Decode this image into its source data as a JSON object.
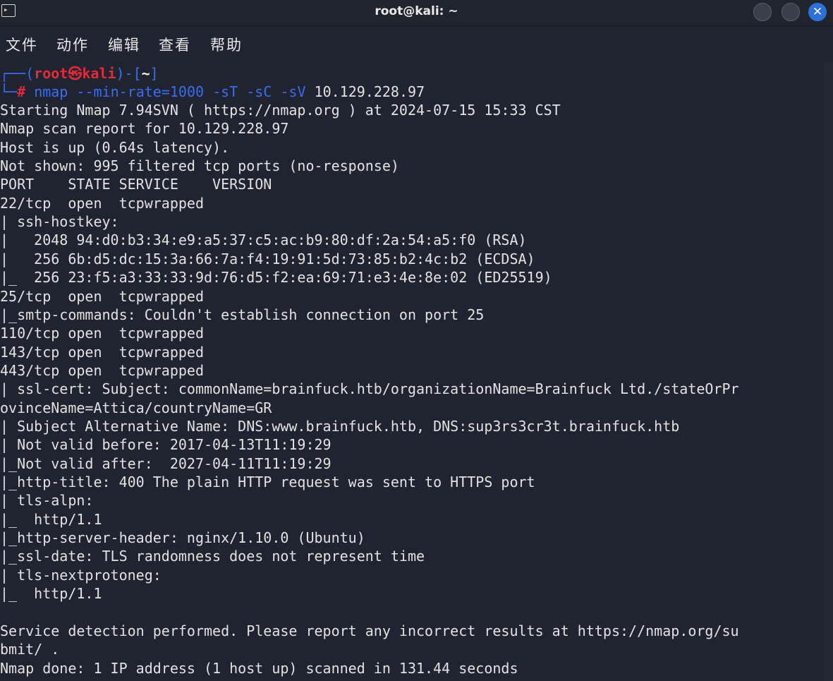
{
  "window": {
    "title": "root@kali: ~",
    "close_glyph": "✕",
    "icon_glyph": "▸"
  },
  "menu": {
    "items": [
      "文件",
      "动作",
      "编辑",
      "查看",
      "帮助"
    ]
  },
  "prompt": {
    "frame_open": "┌──(",
    "user": "root㉿kali",
    "frame_mid": ")-[",
    "dir": "~",
    "frame_close": "]",
    "frame_bottom": "└─",
    "hash": "#",
    "command": "nmap",
    "args": "--min-rate=1000 -sT -sC -sV",
    "target": "10.129.228.97"
  },
  "output": [
    "Starting Nmap 7.94SVN ( https://nmap.org ) at 2024-07-15 15:33 CST",
    "Nmap scan report for 10.129.228.97",
    "Host is up (0.64s latency).",
    "Not shown: 995 filtered tcp ports (no-response)",
    "PORT    STATE SERVICE    VERSION",
    "22/tcp  open  tcpwrapped",
    "| ssh-hostkey:",
    "|   2048 94:d0:b3:34:e9:a5:37:c5:ac:b9:80:df:2a:54:a5:f0 (RSA)",
    "|   256 6b:d5:dc:15:3a:66:7a:f4:19:91:5d:73:85:b2:4c:b2 (ECDSA)",
    "|_  256 23:f5:a3:33:33:9d:76:d5:f2:ea:69:71:e3:4e:8e:02 (ED25519)",
    "25/tcp  open  tcpwrapped",
    "|_smtp-commands: Couldn't establish connection on port 25",
    "110/tcp open  tcpwrapped",
    "143/tcp open  tcpwrapped",
    "443/tcp open  tcpwrapped",
    "| ssl-cert: Subject: commonName=brainfuck.htb/organizationName=Brainfuck Ltd./stateOrPr",
    "ovinceName=Attica/countryName=GR",
    "| Subject Alternative Name: DNS:www.brainfuck.htb, DNS:sup3rs3cr3t.brainfuck.htb",
    "| Not valid before: 2017-04-13T11:19:29",
    "|_Not valid after:  2027-04-11T11:19:29",
    "|_http-title: 400 The plain HTTP request was sent to HTTPS port",
    "| tls-alpn:",
    "|_  http/1.1",
    "|_http-server-header: nginx/1.10.0 (Ubuntu)",
    "|_ssl-date: TLS randomness does not represent time",
    "| tls-nextprotoneg:",
    "|_  http/1.1",
    "",
    "Service detection performed. Please report any incorrect results at https://nmap.org/su",
    "bmit/ .",
    "Nmap done: 1 IP address (1 host up) scanned in 131.44 seconds"
  ]
}
